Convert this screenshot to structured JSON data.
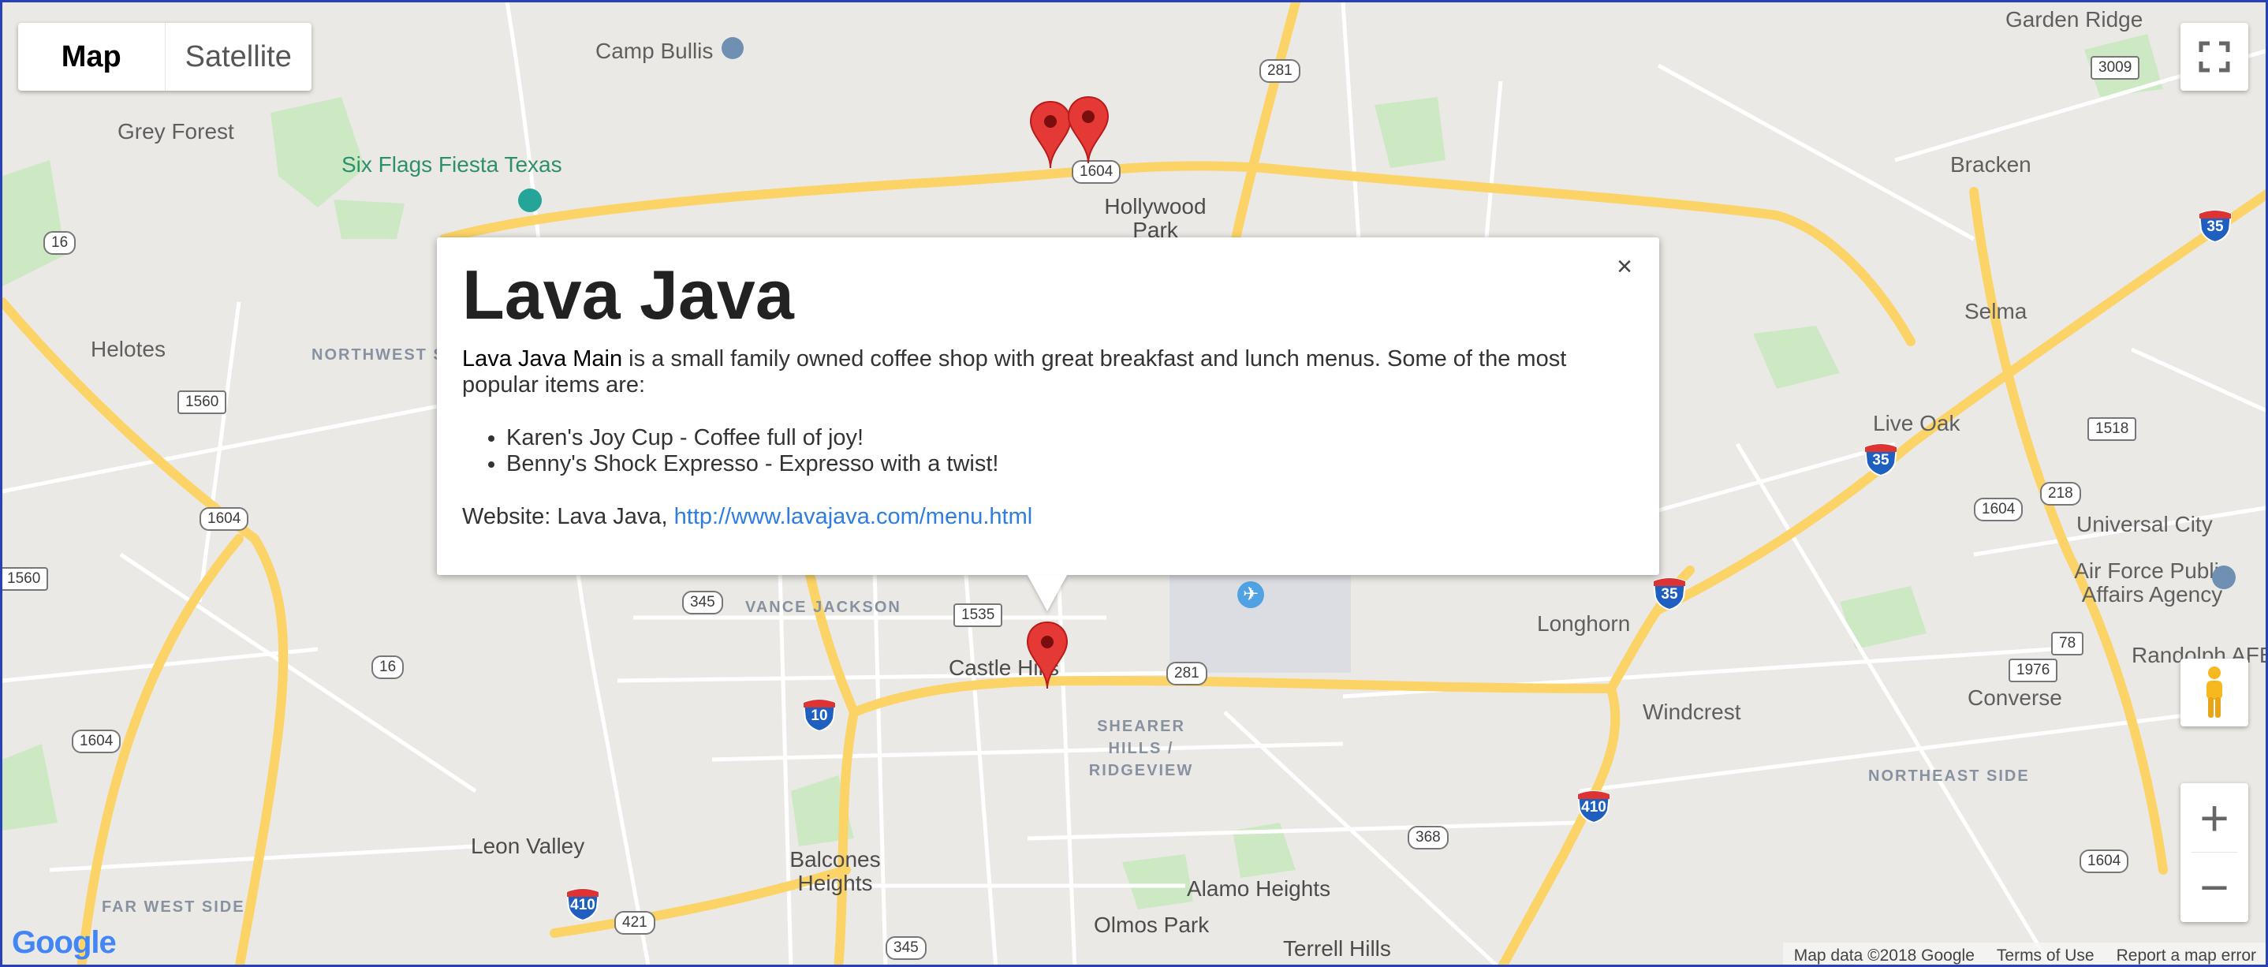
{
  "map_type": {
    "map_label": "Map",
    "satellite_label": "Satellite",
    "selected": "Map"
  },
  "places": {
    "garden_ridge": "Garden Ridge",
    "camp_bullis": "Camp Bullis",
    "grey_forest": "Grey Forest",
    "six_flags": "Six Flags Fiesta Texas",
    "hollywood_park": "Hollywood Park",
    "bracken": "Bracken",
    "selma": "Selma",
    "helotes": "Helotes",
    "northwest_side": "NORTHWEST S",
    "live_oak": "Live Oak",
    "universal_city": "Universal City",
    "afb_public": "Air Force Public Affairs Agency",
    "longhorn": "Longhorn",
    "randolph": "Randolph AFB",
    "vance_jackson": "VANCE JACKSON",
    "castle_hills": "Castle Hills",
    "shearer_hills": "SHEARER HILLS / RIDGEVIEW",
    "windcrest": "Windcrest",
    "converse": "Converse",
    "northeast_side": "NORTHEAST SIDE",
    "leon_valley": "Leon Valley",
    "balcones_heights": "Balcones Heights",
    "alamo_heights": "Alamo Heights",
    "olmos_park": "Olmos Park",
    "terrell_hills": "Terrell Hills",
    "far_west_side": "FAR WEST SIDE"
  },
  "shields": {
    "r3009": "3009",
    "r281a": "281",
    "r1604a": "1604",
    "r16a": "16",
    "r1560": "1560",
    "r1604b": "1604",
    "r1560b": "1560",
    "r345a": "345",
    "r1535": "1535",
    "r281b": "281",
    "r16b": "16",
    "r1604c": "1604",
    "r368": "368",
    "r421": "421",
    "r345b": "345",
    "r1518": "1518",
    "r218": "218",
    "r1604d": "1604",
    "r78": "78",
    "r1976": "1976",
    "r1604e": "1604"
  },
  "interstates": {
    "i35a": "35",
    "i35b": "35",
    "i35c": "35",
    "i10": "10",
    "i410a": "410",
    "i410b": "410"
  },
  "info_window": {
    "title": "Lava Java",
    "name": "Lava Java Main",
    "description": " is a small family owned coffee shop with great breakfast and lunch menus. Some of the most popular items are:",
    "items": [
      "Karen's Joy Cup - Coffee full of joy!",
      "Benny's Shock Expresso - Expresso with a twist!"
    ],
    "website_label": "Website: Lava Java, ",
    "website_url": "http://www.lavajava.com/menu.html",
    "close_glyph": "×"
  },
  "zoom": {
    "in": "+",
    "out": "−"
  },
  "logo": {
    "text": "Google"
  },
  "attribution": {
    "map_data": "Map data ©2018 Google",
    "terms": "Terms of Use",
    "report": "Report a map error"
  },
  "colors": {
    "marker": "#e53935",
    "highway": "#fbd366",
    "link": "#2e7de0"
  }
}
